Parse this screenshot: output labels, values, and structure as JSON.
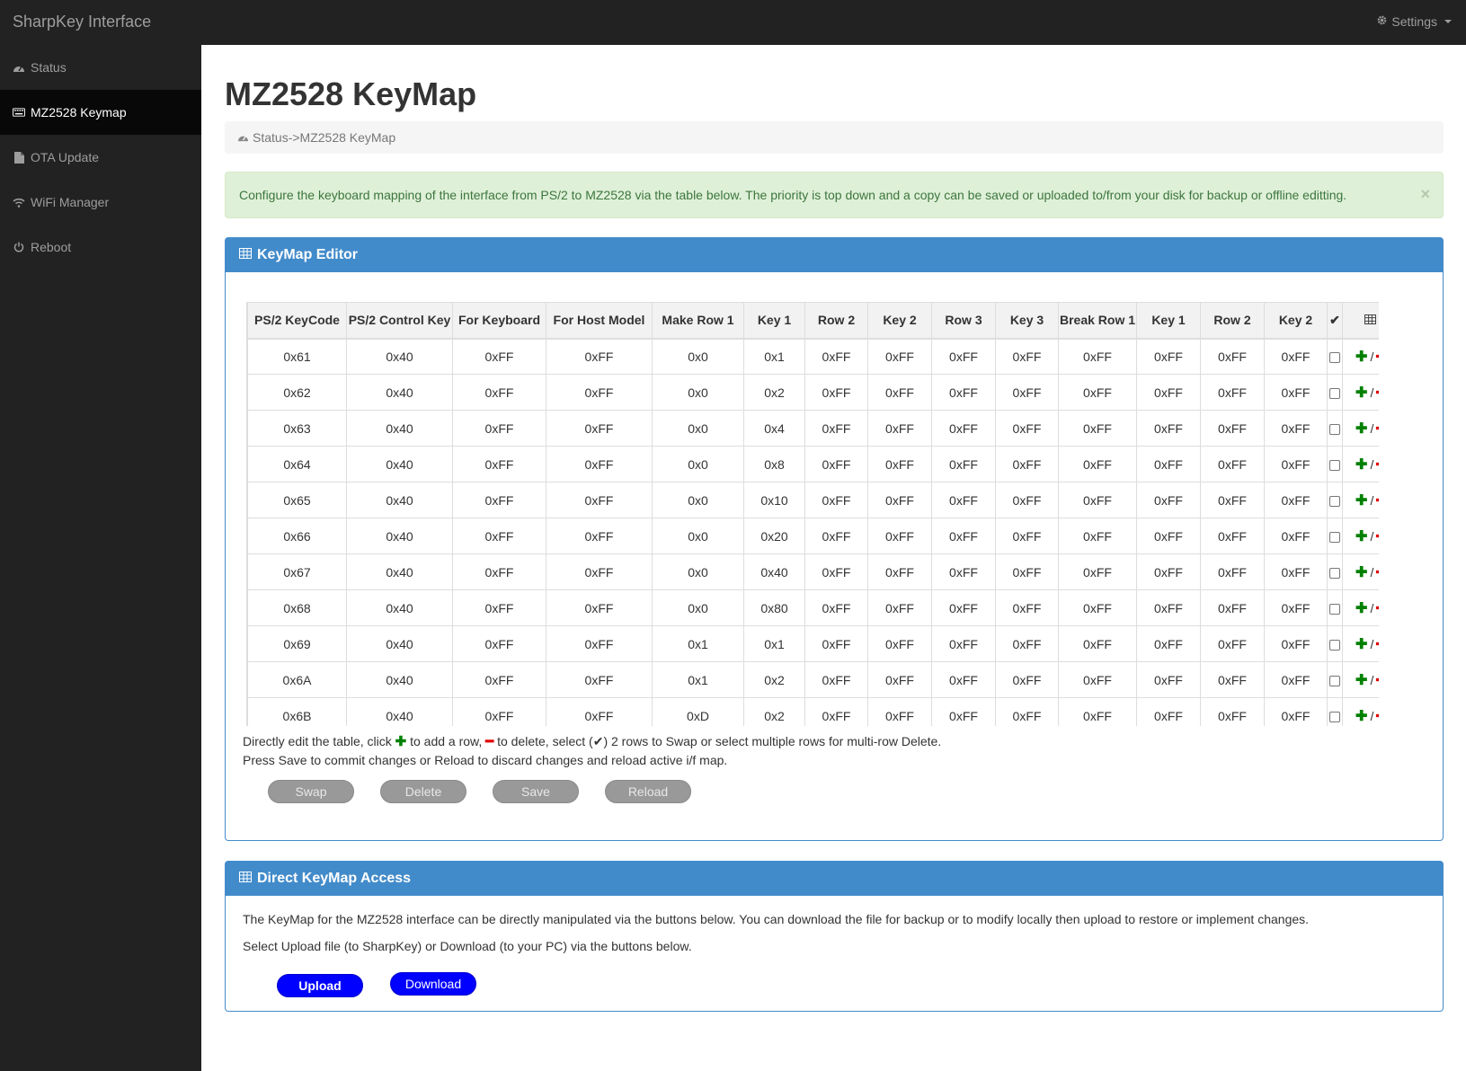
{
  "topnav": {
    "brand": "SharpKey Interface",
    "settings_label": "Settings",
    "settings_icon": "gear-icon"
  },
  "sidebar": {
    "items": [
      {
        "label": "Status",
        "icon": "dashboard-icon",
        "active": false
      },
      {
        "label": "MZ2528 Keymap",
        "icon": "keyboard-icon",
        "active": true
      },
      {
        "label": "OTA Update",
        "icon": "file-icon",
        "active": false
      },
      {
        "label": "WiFi Manager",
        "icon": "wifi-icon",
        "active": false
      },
      {
        "label": "Reboot",
        "icon": "power-icon",
        "active": false
      }
    ]
  },
  "main": {
    "title": "MZ2528 KeyMap",
    "breadcrumb": "Status->MZ2528 KeyMap",
    "alert": "Configure the keyboard mapping of the interface from PS/2 to MZ2528 via the table below. The priority is top down and a copy can be saved or uploaded to/from your disk for backup or offline editting.",
    "alert_close": "×"
  },
  "editor": {
    "title": "KeyMap Editor",
    "columns": [
      "PS/2 KeyCode",
      "PS/2 Control Key",
      "For Keyboard",
      "For Host Model",
      "Make Row 1",
      "Key 1",
      "Row 2",
      "Key 2",
      "Row 3",
      "Key 3",
      "Break Row 1",
      "Key 1",
      "Row 2",
      "Key 2"
    ],
    "rows": [
      [
        "0x61",
        "0x40",
        "0xFF",
        "0xFF",
        "0x0",
        "0x1",
        "0xFF",
        "0xFF",
        "0xFF",
        "0xFF",
        "0xFF",
        "0xFF",
        "0xFF",
        "0xFF"
      ],
      [
        "0x62",
        "0x40",
        "0xFF",
        "0xFF",
        "0x0",
        "0x2",
        "0xFF",
        "0xFF",
        "0xFF",
        "0xFF",
        "0xFF",
        "0xFF",
        "0xFF",
        "0xFF"
      ],
      [
        "0x63",
        "0x40",
        "0xFF",
        "0xFF",
        "0x0",
        "0x4",
        "0xFF",
        "0xFF",
        "0xFF",
        "0xFF",
        "0xFF",
        "0xFF",
        "0xFF",
        "0xFF"
      ],
      [
        "0x64",
        "0x40",
        "0xFF",
        "0xFF",
        "0x0",
        "0x8",
        "0xFF",
        "0xFF",
        "0xFF",
        "0xFF",
        "0xFF",
        "0xFF",
        "0xFF",
        "0xFF"
      ],
      [
        "0x65",
        "0x40",
        "0xFF",
        "0xFF",
        "0x0",
        "0x10",
        "0xFF",
        "0xFF",
        "0xFF",
        "0xFF",
        "0xFF",
        "0xFF",
        "0xFF",
        "0xFF"
      ],
      [
        "0x66",
        "0x40",
        "0xFF",
        "0xFF",
        "0x0",
        "0x20",
        "0xFF",
        "0xFF",
        "0xFF",
        "0xFF",
        "0xFF",
        "0xFF",
        "0xFF",
        "0xFF"
      ],
      [
        "0x67",
        "0x40",
        "0xFF",
        "0xFF",
        "0x0",
        "0x40",
        "0xFF",
        "0xFF",
        "0xFF",
        "0xFF",
        "0xFF",
        "0xFF",
        "0xFF",
        "0xFF"
      ],
      [
        "0x68",
        "0x40",
        "0xFF",
        "0xFF",
        "0x0",
        "0x80",
        "0xFF",
        "0xFF",
        "0xFF",
        "0xFF",
        "0xFF",
        "0xFF",
        "0xFF",
        "0xFF"
      ],
      [
        "0x69",
        "0x40",
        "0xFF",
        "0xFF",
        "0x1",
        "0x1",
        "0xFF",
        "0xFF",
        "0xFF",
        "0xFF",
        "0xFF",
        "0xFF",
        "0xFF",
        "0xFF"
      ],
      [
        "0x6A",
        "0x40",
        "0xFF",
        "0xFF",
        "0x1",
        "0x2",
        "0xFF",
        "0xFF",
        "0xFF",
        "0xFF",
        "0xFF",
        "0xFF",
        "0xFF",
        "0xFF"
      ],
      [
        "0x6B",
        "0x40",
        "0xFF",
        "0xFF",
        "0xD",
        "0x2",
        "0xFF",
        "0xFF",
        "0xFF",
        "0xFF",
        "0xFF",
        "0xFF",
        "0xFF",
        "0xFF"
      ],
      [
        "",
        "",
        "",
        "",
        "",
        "",
        "",
        "",
        "",
        "",
        "",
        "",
        "",
        ""
      ]
    ],
    "help_part1": "Directly edit the table, click ",
    "help_part2": " to add a row, ",
    "help_part3": " to delete, select (",
    "help_part4": ") 2 rows to Swap or select multiple rows for multi-row Delete.",
    "help_line2": "Press Save to commit changes or Reload to discard changes and reload active i/f map.",
    "plus_glyph": "✚",
    "minus_glyph": "━",
    "check_glyph": "✔",
    "slash": "/",
    "buttons": {
      "swap": "Swap",
      "delete": "Delete",
      "save": "Save",
      "reload": "Reload"
    }
  },
  "direct": {
    "title": "Direct KeyMap Access",
    "text1": "The KeyMap for the MZ2528  interface can be directly manipulated via the buttons below. You can download the file for backup or to modify locally then upload to restore or implement changes.",
    "text2": "Select Upload file (to SharpKey) or Download (to your PC) via the buttons below.",
    "upload": "Upload",
    "download": "Download"
  },
  "colors": {
    "navbar": "#222222",
    "panel_header": "#428bca",
    "alert_bg": "#dff0d8",
    "alert_text": "#3c763d",
    "add": "#008000",
    "delete": "#e00000",
    "action_button": "#0000ff",
    "disabled_button": "#999999"
  }
}
